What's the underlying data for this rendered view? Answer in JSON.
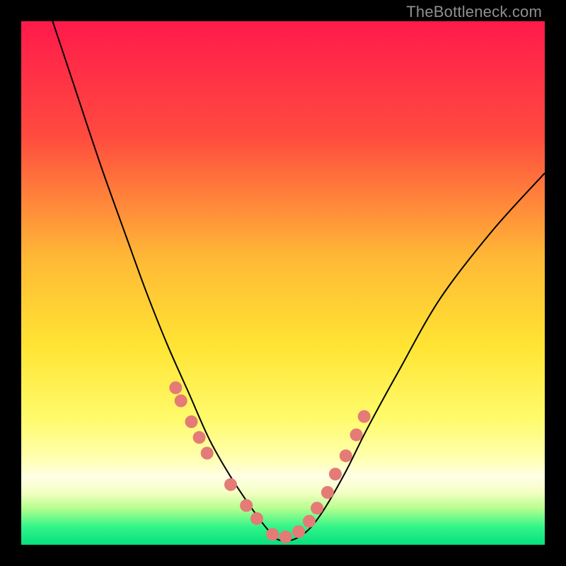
{
  "watermark": "TheBottleneck.com",
  "chart_data": {
    "type": "line",
    "title": "",
    "xlabel": "",
    "ylabel": "",
    "xlim": [
      0,
      1
    ],
    "ylim": [
      0,
      1
    ],
    "grid": false,
    "legend": false,
    "background_gradient_stops": [
      {
        "offset": 0.0,
        "color": "#ff1a4b"
      },
      {
        "offset": 0.22,
        "color": "#ff4b3f"
      },
      {
        "offset": 0.45,
        "color": "#ffb836"
      },
      {
        "offset": 0.62,
        "color": "#ffe433"
      },
      {
        "offset": 0.76,
        "color": "#fffb6c"
      },
      {
        "offset": 0.835,
        "color": "#ffffb0"
      },
      {
        "offset": 0.87,
        "color": "#ffffe6"
      },
      {
        "offset": 0.9,
        "color": "#f4ffc4"
      },
      {
        "offset": 0.93,
        "color": "#b7fe8f"
      },
      {
        "offset": 0.965,
        "color": "#34f589"
      },
      {
        "offset": 1.0,
        "color": "#06e07d"
      }
    ],
    "series": [
      {
        "name": "bottleneck-curve",
        "stroke": "#000000",
        "x": [
          0.06,
          0.1,
          0.15,
          0.2,
          0.24,
          0.28,
          0.32,
          0.36,
          0.4,
          0.44,
          0.47,
          0.49,
          0.52,
          0.55,
          0.58,
          0.62,
          0.66,
          0.72,
          0.8,
          0.9,
          1.0
        ],
        "y": [
          1.0,
          0.88,
          0.73,
          0.59,
          0.48,
          0.38,
          0.29,
          0.2,
          0.13,
          0.07,
          0.03,
          0.01,
          0.01,
          0.03,
          0.07,
          0.14,
          0.22,
          0.33,
          0.47,
          0.6,
          0.71
        ]
      }
    ],
    "markers": {
      "name": "curve-dots",
      "color": "#e47b76",
      "radius_px": 9,
      "x": [
        0.295,
        0.305,
        0.325,
        0.34,
        0.355,
        0.4,
        0.43,
        0.45,
        0.48,
        0.505,
        0.53,
        0.55,
        0.565,
        0.585,
        0.6,
        0.62,
        0.64,
        0.655
      ],
      "y": [
        0.3,
        0.275,
        0.235,
        0.205,
        0.175,
        0.115,
        0.075,
        0.05,
        0.02,
        0.015,
        0.025,
        0.045,
        0.07,
        0.1,
        0.135,
        0.17,
        0.21,
        0.245
      ]
    },
    "annotations": [
      {
        "text": "TheBottleneck.com",
        "position": "top-right",
        "color": "#8f8f8f"
      }
    ]
  }
}
